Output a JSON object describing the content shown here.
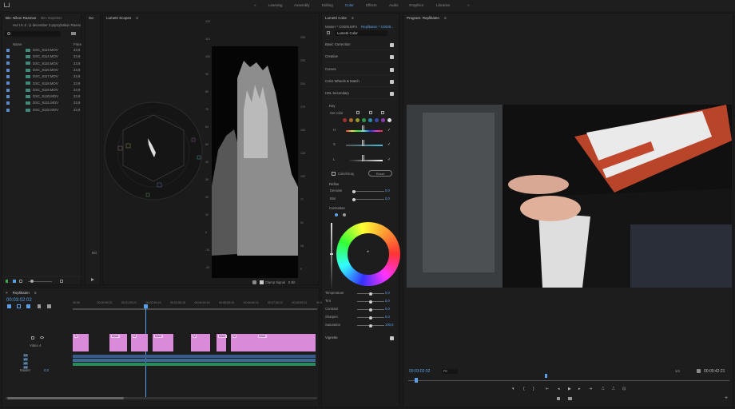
{
  "workspaces": [
    "Learning",
    "Assembly",
    "Editing",
    "Color",
    "Effects",
    "Audio",
    "Graphics",
    "Libraries"
  ],
  "active_workspace": "Color",
  "project": {
    "tabs": [
      "Bin: Nikon Rasmus",
      "Bin: Exporter"
    ],
    "path": "Hur t.k..Il .(1 december 2.prproj\\Nikon Rasmus",
    "col_name": "Name",
    "col_fr": "Fram",
    "clips": [
      {
        "name": "DSC_9113.MOV",
        "fps": "23,9"
      },
      {
        "name": "DSC_9114.MOV",
        "fps": "23,9"
      },
      {
        "name": "DSC_9115.MOV",
        "fps": "23,9"
      },
      {
        "name": "DSC_9116.MOV",
        "fps": "23,9"
      },
      {
        "name": "DSC_9117.MOV",
        "fps": "23,9"
      },
      {
        "name": "DSC_9118.MOV",
        "fps": "23,9"
      },
      {
        "name": "DSC_9119.MOV",
        "fps": "23,9"
      },
      {
        "name": "DSC_9130.MOV",
        "fps": "23,9"
      },
      {
        "name": "DSC_9131.MOV",
        "fps": "23,9"
      },
      {
        "name": "DSC_9132.MOV",
        "fps": "23,9"
      }
    ]
  },
  "source_tab": "So:",
  "scopes": {
    "title": "Lumetri Scopes",
    "left_scale": [
      "120",
      "110",
      "100",
      "90",
      "80",
      "70",
      "60",
      "50",
      "40",
      "30",
      "20",
      "10",
      "0",
      "-10",
      "-20"
    ],
    "right_scale": [
      "255",
      "230",
      "204",
      "179",
      "153",
      "128",
      "102",
      "77",
      "51",
      "26",
      "0"
    ],
    "clamp_label": "Clamp Signal",
    "bit_label": "8 Bit",
    "scope_label": "BG"
  },
  "lumetri": {
    "title": "Lumetri Color",
    "master": "Master * C0009.MP4",
    "clip_tab": "Replikaten * C0009...",
    "effect": "Lumetri Color",
    "sections": [
      "Basic Correction",
      "Creative",
      "Curves",
      "Color Wheels & Match",
      "HSL Secondary"
    ],
    "key_label": "Key",
    "set_color": "Set color",
    "hsl": [
      "H",
      "S",
      "L"
    ],
    "color_gray": "Color/Gray",
    "reset": "Reset",
    "refine": "Refine",
    "denoise": {
      "label": "Denoise",
      "value": "0,0"
    },
    "blur": {
      "label": "Blur",
      "value": "0,0"
    },
    "correction": "Correction",
    "sliders": [
      {
        "label": "Temperature",
        "value": "0,0",
        "pos": 0.5
      },
      {
        "label": "Tint",
        "value": "0,0",
        "pos": 0.5
      },
      {
        "label": "Contrast",
        "value": "0,0",
        "pos": 0.5
      },
      {
        "label": "Sharpen",
        "value": "0,0",
        "pos": 0.5
      },
      {
        "label": "Saturation",
        "value": "100,0",
        "pos": 0.5
      }
    ],
    "vignette": "Vignette"
  },
  "program": {
    "title": "Program: Replikaten",
    "timecode": "00:03:02:02",
    "fit": "Fit",
    "scale": "1/4",
    "duration": "00:00:42:21"
  },
  "timeline": {
    "title": "Replikaten",
    "timecode": "00:03:02:02",
    "ruler": [
      "00:00",
      "00:00:59:22",
      "00:01:59:21",
      "00:02:59:19",
      "00:03:59:18",
      "00:04:59:16",
      "00:05:59:15",
      "00:06:59:13",
      "00:07:59:12",
      "00:08:59:11",
      "00:0"
    ],
    "tracks": [
      "V1",
      "A1",
      "A2",
      "A3"
    ],
    "video_track": "Video 4",
    "master": "Master",
    "master_val": "0,0",
    "clip_labels": [
      "M",
      "Mixer",
      "M",
      "Mixer",
      "M",
      "Mixer",
      "M",
      "Mixer"
    ]
  },
  "colors": {
    "accent": "#5aa0e8",
    "clip": "#d98ad8",
    "audio": "#2a8a5a"
  }
}
